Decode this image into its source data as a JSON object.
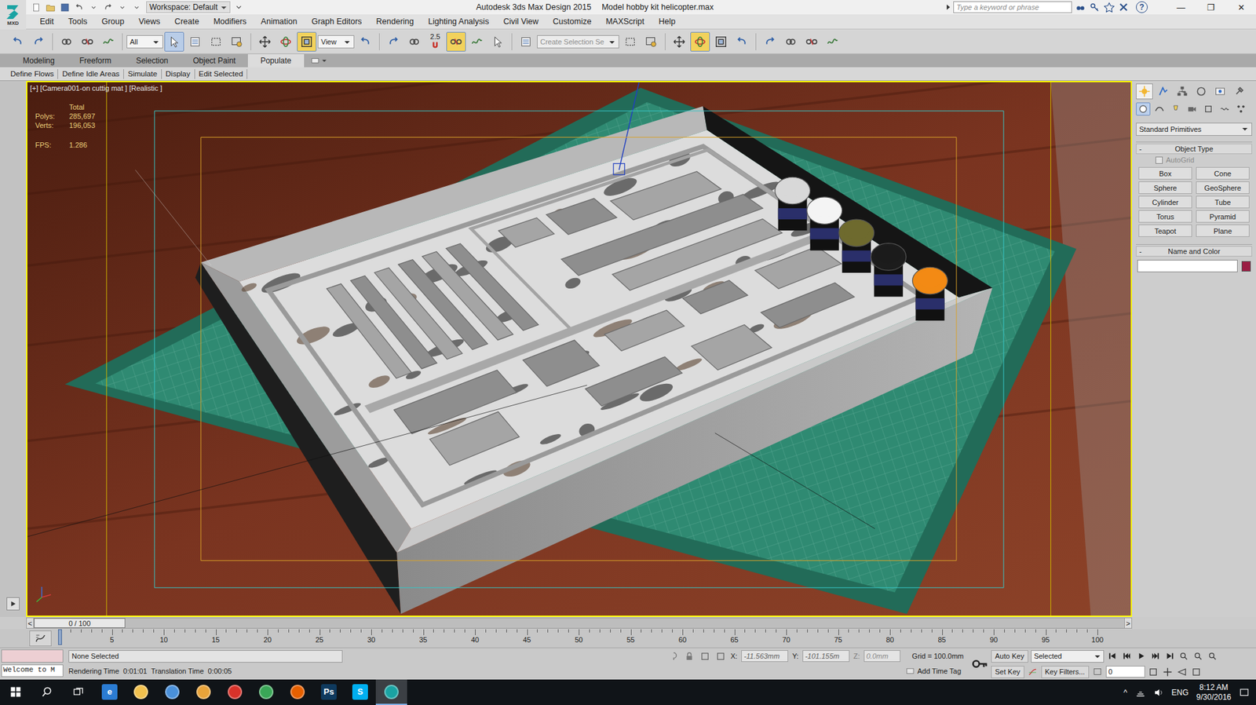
{
  "title_bar": {
    "logo": "MXD",
    "workspace": "Workspace: Default",
    "title": "Autodesk 3ds Max Design 2015",
    "file": "Model hobby kit helicopter.max",
    "search_placeholder": "Type a keyword or phrase",
    "help": "?",
    "window_controls": [
      "—",
      "❐",
      "✕"
    ]
  },
  "menu": [
    "Edit",
    "Tools",
    "Group",
    "Views",
    "Create",
    "Modifiers",
    "Animation",
    "Graph Editors",
    "Rendering",
    "Lighting Analysis",
    "Civil View",
    "Customize",
    "MAXScript",
    "Help"
  ],
  "toolbar": [
    {
      "kind": "icon",
      "active": false
    },
    {
      "kind": "icon",
      "active": false
    },
    {
      "kind": "sep"
    },
    {
      "kind": "icon",
      "active": false
    },
    {
      "kind": "icon",
      "active": false
    },
    {
      "kind": "icon",
      "active": false
    },
    {
      "kind": "sep"
    },
    {
      "kind": "dropdown",
      "text": "All",
      "placeholder": false
    },
    {
      "kind": "icon",
      "active": true
    },
    {
      "kind": "icon",
      "active": false
    },
    {
      "kind": "icon",
      "active": false
    },
    {
      "kind": "icon",
      "active": false
    },
    {
      "kind": "sep"
    },
    {
      "kind": "icon",
      "active": false
    },
    {
      "kind": "icon",
      "active": false
    },
    {
      "kind": "icon",
      "active": true
    },
    {
      "kind": "dropdown",
      "text": "View",
      "placeholder": false
    },
    {
      "kind": "icon",
      "active": false
    },
    {
      "kind": "sep"
    },
    {
      "kind": "icon",
      "active": false
    },
    {
      "kind": "icon",
      "active": false
    },
    {
      "kind": "snap",
      "text": "2.5",
      "active": false
    },
    {
      "kind": "icon",
      "active": true
    },
    {
      "kind": "icon",
      "active": false
    },
    {
      "kind": "icon",
      "active": false
    },
    {
      "kind": "sep"
    },
    {
      "kind": "icon",
      "active": false
    },
    {
      "kind": "dropdown",
      "text": "Create Selection Se",
      "placeholder": true
    },
    {
      "kind": "icon",
      "active": false
    },
    {
      "kind": "icon",
      "active": false
    },
    {
      "kind": "sep"
    },
    {
      "kind": "icon",
      "active": false
    },
    {
      "kind": "icon",
      "active": true
    },
    {
      "kind": "icon",
      "active": false
    },
    {
      "kind": "icon",
      "active": false
    },
    {
      "kind": "sep"
    },
    {
      "kind": "icon",
      "active": false
    },
    {
      "kind": "icon",
      "active": false
    },
    {
      "kind": "icon",
      "active": false
    },
    {
      "kind": "icon",
      "active": false
    }
  ],
  "ribbon": {
    "tabs": [
      {
        "label": "Modeling",
        "selected": false
      },
      {
        "label": "Freeform",
        "selected": false
      },
      {
        "label": "Selection",
        "selected": false
      },
      {
        "label": "Object Paint",
        "selected": false
      },
      {
        "label": "Populate",
        "selected": true
      }
    ],
    "items": [
      "Define Flows",
      "Define Idle Areas",
      "Simulate",
      "Display",
      "Edit Selected"
    ]
  },
  "viewport": {
    "label": "[+] [Camera001-on cuttig mat ] [Realistic ]",
    "active": true,
    "stats": {
      "heading": "Total",
      "rows": [
        {
          "label": "Polys:",
          "value": "285,697"
        },
        {
          "label": "Verts:",
          "value": "196,053"
        }
      ],
      "fps": {
        "label": "FPS:",
        "value": "1.286"
      }
    }
  },
  "command_panel": {
    "tabs": [
      {
        "selected": true
      },
      {
        "selected": false
      },
      {
        "selected": false
      },
      {
        "selected": false
      },
      {
        "selected": false
      },
      {
        "selected": false
      }
    ],
    "categories": [
      {
        "selected": true
      },
      {
        "selected": false
      },
      {
        "selected": false
      },
      {
        "selected": false
      },
      {
        "selected": false
      },
      {
        "selected": false
      },
      {
        "selected": false
      }
    ],
    "dropdown": "Standard Primitives",
    "object_type": {
      "toggle": "-",
      "title": "Object Type",
      "autogrid": {
        "label": "AutoGrid",
        "checked": false,
        "disabled": true
      },
      "buttons": [
        "Box",
        "Cone",
        "Sphere",
        "GeoSphere",
        "Cylinder",
        "Tube",
        "Torus",
        "Pyramid",
        "Teapot",
        "Plane"
      ]
    },
    "name_and_color": {
      "toggle": "-",
      "title": "Name and Color",
      "name": "",
      "color": "#9b1c43"
    }
  },
  "time_slider": {
    "prev": "<",
    "next": ">",
    "reading": "0 / 100",
    "level": 0
  },
  "track_bar": {
    "labels": [
      "5",
      "10",
      "15",
      "20",
      "25",
      "30",
      "35",
      "40",
      "45",
      "50",
      "55",
      "60",
      "65",
      "70",
      "75",
      "80",
      "85",
      "90",
      "95",
      "100"
    ]
  },
  "status": {
    "selection": "None Selected",
    "welcome": "Welcome to M",
    "rendering_time": "Rendering Time  0:01:01",
    "translation_time": "Translation Time  0:00:05",
    "x_label": "X:",
    "x": "-11.563mm",
    "y_label": "Y:",
    "y": "-101.155m",
    "z_label": "Z:",
    "z": "0.0mm",
    "grid": "Grid = 100.0mm",
    "auto_key": "Auto Key",
    "key_mode": "Selected",
    "set_key": "Set Key",
    "key_filters": "Key Filters...",
    "frame": "0",
    "add_time_tag": "Add Time Tag"
  },
  "taskbar": {
    "apps": [
      {
        "glyph": "e",
        "color": "#2b7cd3",
        "active": false
      },
      {
        "glyph": "",
        "color": "#f2c14e",
        "active": false
      },
      {
        "glyph": "",
        "color": "#4a90d9",
        "active": false
      },
      {
        "glyph": "",
        "color": "#e8a33a",
        "active": false
      },
      {
        "glyph": "",
        "color": "#d8322a",
        "active": false
      },
      {
        "glyph": "",
        "color": "#3aa757",
        "active": false
      },
      {
        "glyph": "",
        "color": "#e66000",
        "active": false
      },
      {
        "glyph": "Ps",
        "color": "#0f3a5e",
        "active": false
      },
      {
        "glyph": "S",
        "color": "#00aff0",
        "active": false
      },
      {
        "glyph": "",
        "color": "#1aa3a3",
        "active": true
      }
    ],
    "tray": {
      "chevron": "^",
      "language": "ENG",
      "time": "8:12 AM",
      "date": "9/30/2016"
    }
  }
}
